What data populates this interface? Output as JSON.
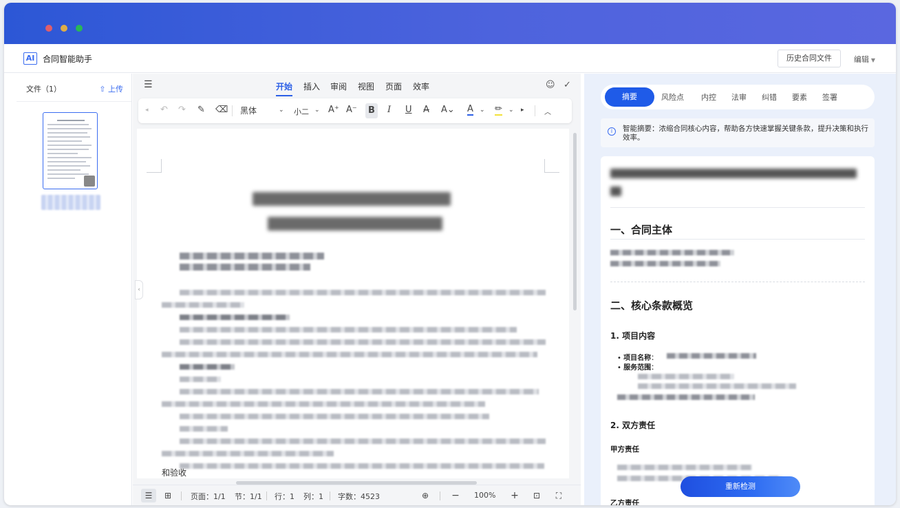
{
  "app": {
    "title": "合同智能助手",
    "logo": "AI",
    "history_button": "历史合同文件",
    "edit_menu": "编辑"
  },
  "file_panel": {
    "header": "文件（1）",
    "upload": "上传"
  },
  "editor": {
    "tabs": [
      {
        "label": "开始",
        "active": true
      },
      {
        "label": "插入",
        "active": false
      },
      {
        "label": "审阅",
        "active": false
      },
      {
        "label": "视图",
        "active": false
      },
      {
        "label": "页面",
        "active": false
      },
      {
        "label": "效率",
        "active": false
      }
    ],
    "toolbar": {
      "font_family": "黑体",
      "font_size": "小二",
      "bold": "B",
      "italic": "I",
      "underline": "U"
    },
    "page_tail_text": "和验收"
  },
  "statusbar": {
    "page": "页面：1/1",
    "section": "节：1/1",
    "row": "行：1",
    "col": "列：1",
    "words": "字数：4523",
    "zoom": "100%"
  },
  "assistant": {
    "tabs": [
      {
        "label": "摘要",
        "active": true
      },
      {
        "label": "风险点",
        "active": false
      },
      {
        "label": "内控",
        "active": false
      },
      {
        "label": "法审",
        "active": false
      },
      {
        "label": "纠错",
        "active": false
      },
      {
        "label": "要素",
        "active": false
      },
      {
        "label": "签署",
        "active": false
      }
    ],
    "info": "智能摘要：浓缩合同核心内容，帮助各方快速掌握关键条款，提升决策和执行效率。",
    "sections": {
      "s1": "一、合同主体",
      "s2": "二、核心条款概览",
      "s2_1": "1. 项目内容",
      "project_name_label": "项目名称",
      "service_scope_label": "服务范围",
      "s2_2": "2. 双方责任",
      "party_a": "甲方责任",
      "party_b": "乙方责任"
    },
    "recheck_button": "重新检测"
  },
  "colors": {
    "accent": "#1f5be8",
    "titlebar": "#3a5bdc"
  }
}
